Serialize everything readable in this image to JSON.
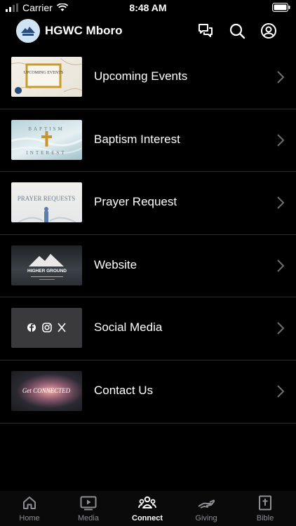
{
  "status_bar": {
    "carrier": "Carrier",
    "time": "8:48 AM"
  },
  "header": {
    "title": "HGWC Mboro",
    "icons": [
      "chat-icon",
      "search-icon",
      "account-icon"
    ]
  },
  "list": {
    "items": [
      {
        "label": "Upcoming Events",
        "thumb_text": "UPCOMING EVENTS"
      },
      {
        "label": "Baptism Interest",
        "thumb_text_top": "BAPTISM",
        "thumb_text_bottom": "INTEREST"
      },
      {
        "label": "Prayer Request",
        "thumb_text": "PRAYER REQUESTS"
      },
      {
        "label": "Website",
        "thumb_text": "HIGHER GROUND"
      },
      {
        "label": "Social Media"
      },
      {
        "label": "Contact Us",
        "thumb_text": "Get CONNECTED"
      }
    ]
  },
  "tabbar": {
    "tabs": [
      {
        "label": "Home",
        "icon": "home-icon"
      },
      {
        "label": "Media",
        "icon": "media-icon"
      },
      {
        "label": "Connect",
        "icon": "connect-icon",
        "active": true
      },
      {
        "label": "Giving",
        "icon": "giving-icon"
      },
      {
        "label": "Bible",
        "icon": "bible-icon"
      }
    ]
  }
}
